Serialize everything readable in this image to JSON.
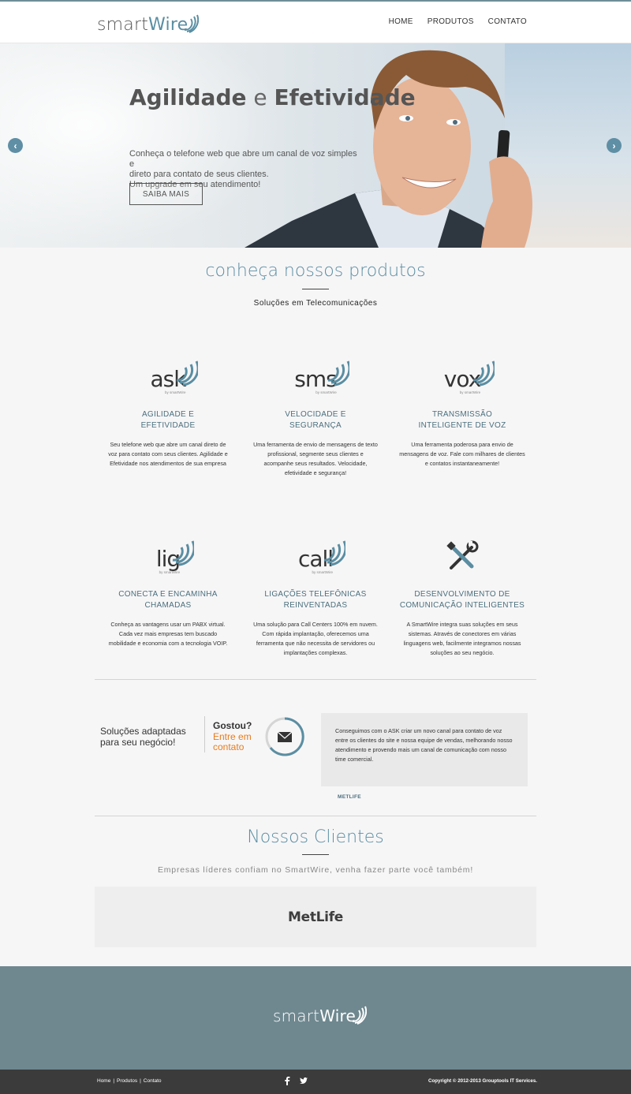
{
  "brand": {
    "name_prefix": "smart",
    "name_suffix": "Wire",
    "accent": "#5a8ea2",
    "orange": "#e67c1c",
    "footer_bg": "#6f8890",
    "bottom_bg": "#3b3b3b"
  },
  "nav": {
    "home": "HOME",
    "produtos": "PRODUTOS",
    "contato": "CONTATO"
  },
  "hero": {
    "title_part1": "Agilidade",
    "title_conj": " e ",
    "title_part2": "Efetividade",
    "text_line1": "Conheça o telefone web que abre um canal de voz simples e",
    "text_line2": "direto para contato de seus clientes.",
    "text_line3": "Um upgrade em seu atendimento!",
    "button": "SAIBA MAIS",
    "prev_icon": "chevron-left-icon",
    "next_icon": "chevron-right-icon"
  },
  "products_section": {
    "title": "conheça nossos produtos",
    "subtitle_part1": "Soluções",
    "subtitle_conj": " em ",
    "subtitle_part2": "Telecomunicações",
    "logo_sub": "by smartWire",
    "items": [
      {
        "logo": "ask",
        "name_line1": "AGILIDADE E",
        "name_line2": "EFETIVIDADE",
        "desc": "Seu telefone web que abre um canal direto de voz para contato com seus clientes. Agilidade e Efetividade nos atendimentos de sua empresa"
      },
      {
        "logo": "sms",
        "name_line1": "VELOCIDADE E",
        "name_line2": "SEGURANÇA",
        "desc": "Uma ferramenta de envio de mensagens de texto profissional, segmente seus clientes e acompanhe seus resultados. Velocidade, efetividade e segurança!"
      },
      {
        "logo": "vox",
        "name_line1": "TRANSMISSÃO",
        "name_line2": "INTELIGENTE DE VOZ",
        "desc": "Uma ferramenta poderosa para envio de mensagens de voz. Fale com milhares de clientes e contatos instantaneamente!"
      },
      {
        "logo": "lig",
        "name_line1": "CONECTA E ENCAMINHA",
        "name_line2": "CHAMADAS",
        "desc": "Conheça as vantagens usar um PABX virtual. Cada vez mais empresas tem buscado mobilidade e economia com a tecnologia VOIP."
      },
      {
        "logo": "call",
        "name_line1": "LIGAÇÕES TELEFÔNICAS",
        "name_line2": "REINVENTADAS",
        "desc": "Uma solução para Call Centers 100% em nuvem. Com rápida implantação, oferecemos uma ferramenta que não necessita de servidores ou implantações complexas."
      },
      {
        "logo": "tools-icon",
        "name_line1": "DESENVOLVIMENTO DE",
        "name_line2": "COMUNICAÇÃO INTELIGENTES",
        "desc": "A SmartWire integra suas soluções em seus sistemas. Através de conectores em várias linguagens web, facilmente integramos nossas soluções ao seu negócio."
      }
    ]
  },
  "contact_strip": {
    "adapt_line1": "Soluções adaptadas",
    "adapt_line2": "para seu negócio!",
    "gostou": "Gostou?",
    "entre_line1": "Entre em",
    "entre_line2": "contato",
    "icon": "envelope-icon",
    "quote": "Conseguimos com o ASK criar um novo canal para contato de voz entre os clientes do site e nossa equipe de vendas, melhorando nosso atendimento e provendo mais um canal de comunicação com nosso time comercial.",
    "quote_author": "METLIFE"
  },
  "clients": {
    "title": "Nossos Clientes",
    "subtitle": "Empresas líderes confiam no SmartWire, venha fazer parte você também!",
    "logo": "MetLife"
  },
  "footer": {
    "links": [
      "Home",
      "Produtos",
      "Contato"
    ],
    "social": [
      "facebook-icon",
      "twitter-icon"
    ],
    "copyright": "Copyright © 2012-2013 Grouptools IT Services."
  }
}
